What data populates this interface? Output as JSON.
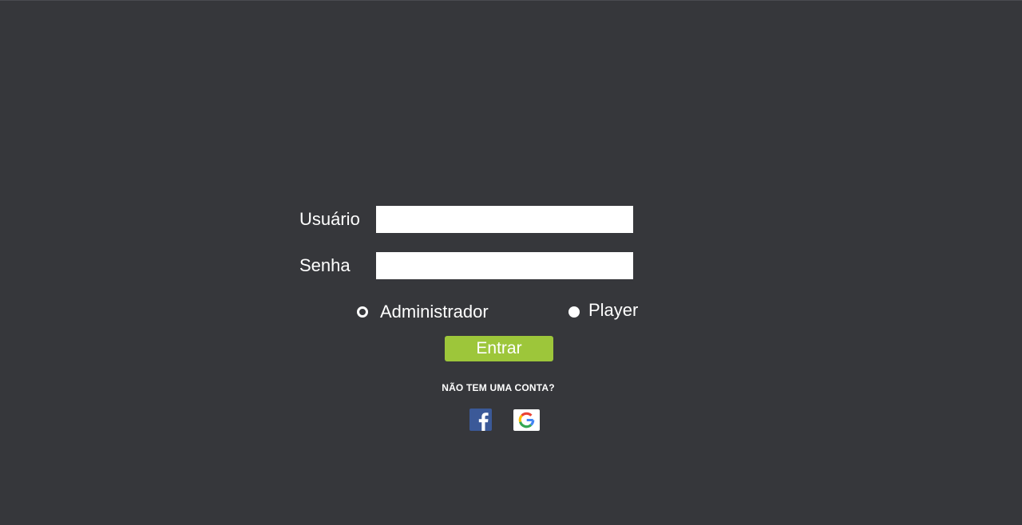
{
  "form": {
    "username_label": "Usuário",
    "username_value": "",
    "password_label": "Senha",
    "password_value": "",
    "roles": [
      {
        "label": "Administrador",
        "selected": false
      },
      {
        "label": "Player",
        "selected": true
      }
    ],
    "submit_label": "Entrar",
    "signup_prompt": "NÃO TEM UMA CONTA?"
  },
  "social": {
    "facebook_icon": "facebook-icon",
    "google_icon": "google-icon"
  },
  "colors": {
    "background": "#36373b",
    "accent": "#9dc63a",
    "facebook": "#3b5998"
  }
}
